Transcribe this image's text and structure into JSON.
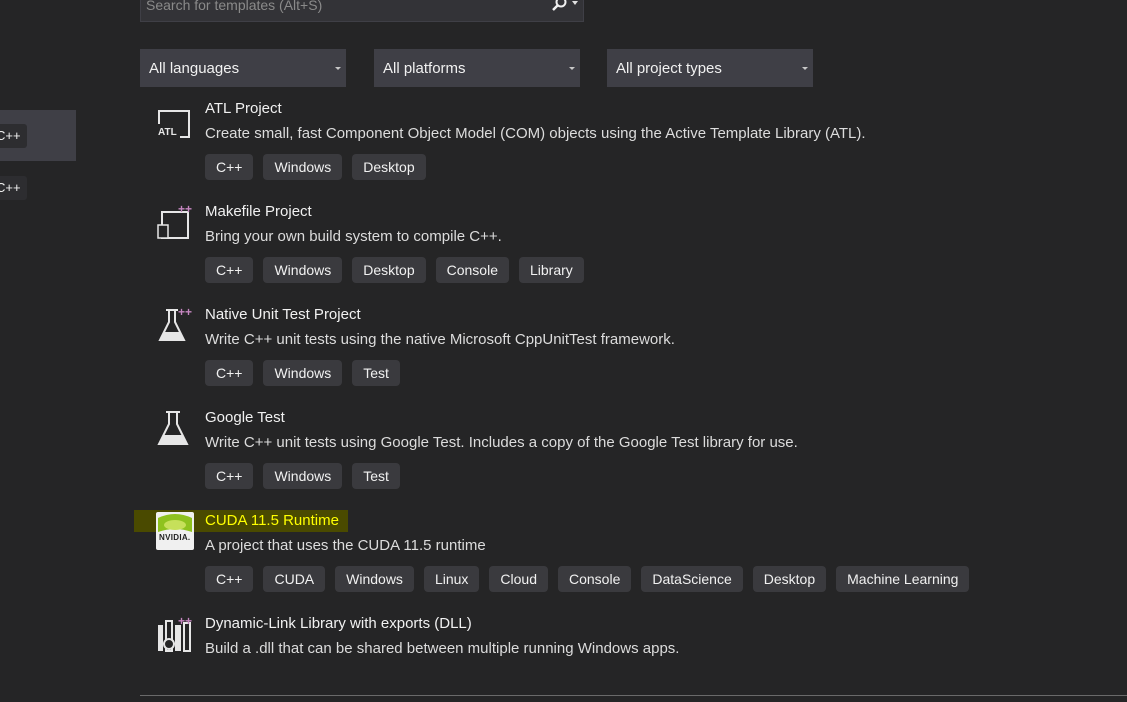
{
  "search": {
    "placeholder": "Search for templates (Alt+S)",
    "icon": "search-icon"
  },
  "filters": {
    "languages": "All languages",
    "platforms": "All platforms",
    "project_types": "All project types"
  },
  "recent": {
    "tags": [
      "C++",
      "C++"
    ]
  },
  "templates": [
    {
      "name": "ATL Project",
      "icon": "atl-project-icon",
      "description": "Create small, fast Component Object Model (COM) objects using the Active Template Library (ATL).",
      "tags": [
        "C++",
        "Windows",
        "Desktop"
      ]
    },
    {
      "name": "Makefile Project",
      "icon": "makefile-project-icon",
      "description": "Bring your own build system to compile C++.",
      "tags": [
        "C++",
        "Windows",
        "Desktop",
        "Console",
        "Library"
      ]
    },
    {
      "name": "Native Unit Test Project",
      "icon": "test-flask-icon",
      "description": "Write C++ unit tests using the native Microsoft CppUnitTest framework.",
      "tags": [
        "C++",
        "Windows",
        "Test"
      ]
    },
    {
      "name": "Google Test",
      "icon": "test-flask-icon",
      "description": "Write C++ unit tests using Google Test. Includes a copy of the Google Test library for use.",
      "tags": [
        "C++",
        "Windows",
        "Test"
      ]
    },
    {
      "name": "CUDA 11.5 Runtime",
      "icon": "nvidia-logo-icon",
      "logo_text": "NVIDIA.",
      "description": "A project that uses the CUDA 11.5 runtime",
      "tags": [
        "C++",
        "CUDA",
        "Windows",
        "Linux",
        "Cloud",
        "Console",
        "DataScience",
        "Desktop",
        "Machine Learning"
      ],
      "name_color": "#ffff00"
    },
    {
      "name": "Dynamic-Link Library with exports (DLL)",
      "icon": "dll-library-icon",
      "description": "Build a .dll that can be shared between multiple running Windows apps.",
      "tags": []
    }
  ],
  "colors": {
    "background": "#252526",
    "tag_bg": "#3a3a3e",
    "filter_bg": "#3f3f46",
    "highlight": "#ffff00"
  }
}
